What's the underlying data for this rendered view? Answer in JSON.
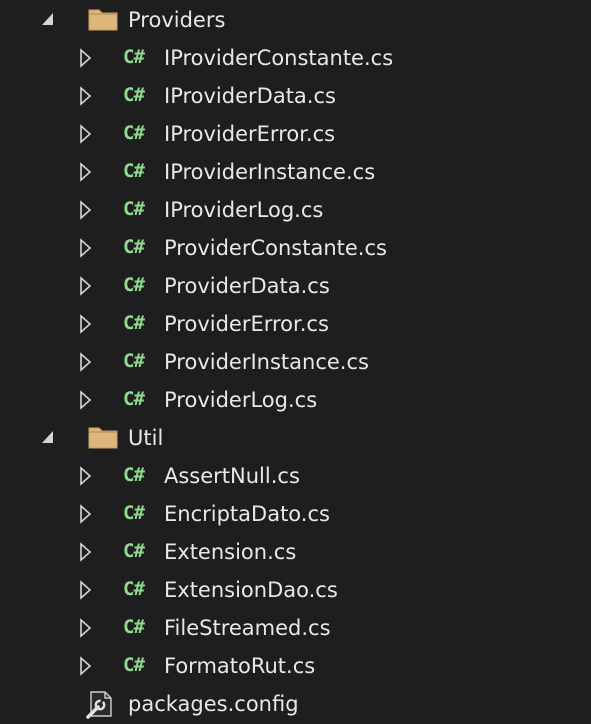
{
  "tree": {
    "folder_providers": {
      "label": "Providers",
      "expanded": true
    },
    "providers_files": [
      "IProviderConstante.cs",
      "IProviderData.cs",
      "IProviderError.cs",
      "IProviderInstance.cs",
      "IProviderLog.cs",
      "ProviderConstante.cs",
      "ProviderData.cs",
      "ProviderError.cs",
      "ProviderInstance.cs",
      "ProviderLog.cs"
    ],
    "folder_util": {
      "label": "Util",
      "expanded": true
    },
    "util_files": [
      "AssertNull.cs",
      "EncriptaDato.cs",
      "Extension.cs",
      "ExtensionDao.cs",
      "FileStreamed.cs",
      "FormatoRut.cs"
    ],
    "packages_config": {
      "label": "packages.config",
      "icon": "config-wrench-icon"
    },
    "cs_icon_text": "C#"
  },
  "colors": {
    "background": "#1e1e1e",
    "text": "#e8e8e8",
    "csharp_icon": "#8fd88f",
    "folder_fill": "#dcb67a"
  }
}
